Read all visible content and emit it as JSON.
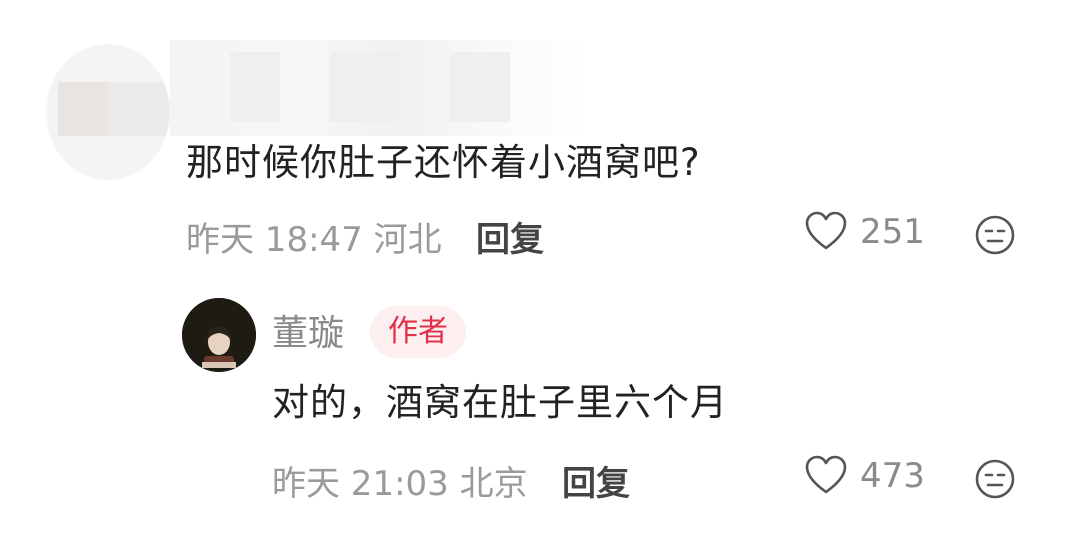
{
  "comments": [
    {
      "user_name": "",
      "text": "那时候你肚子还怀着小酒窝吧?",
      "time": "昨天 18:47",
      "location": "河北",
      "reply_label": "回复",
      "like_count": "251"
    },
    {
      "user_name": "董璇",
      "author_badge": "作者",
      "text": "对的，酒窝在肚子里六个月",
      "time": "昨天 21:03",
      "location": "北京",
      "reply_label": "回复",
      "like_count": "473"
    }
  ],
  "colors": {
    "badge_bg": "#fdeef0",
    "badge_text": "#e2304a",
    "meta_text": "#9a9a9a",
    "body_text": "#222222"
  },
  "icons": {
    "like": "heart-outline-icon",
    "dislike": "neutral-face-icon"
  }
}
